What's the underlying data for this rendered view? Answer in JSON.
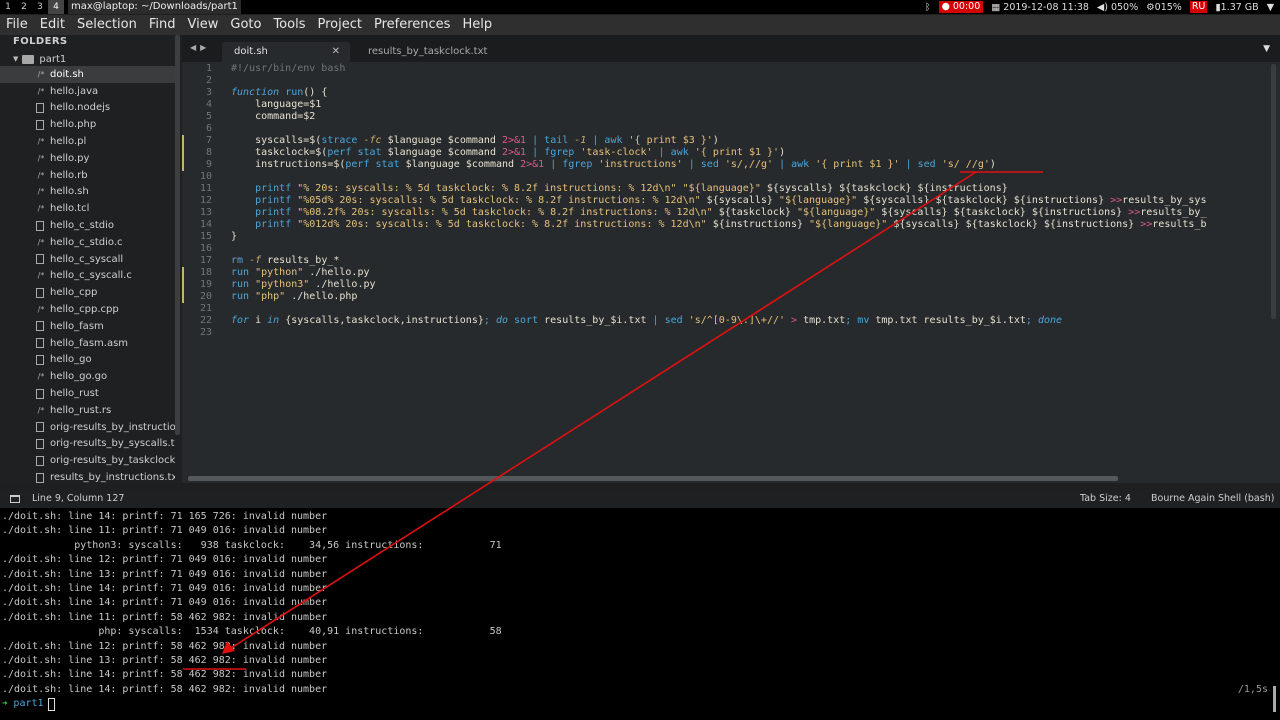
{
  "topbar": {
    "workspaces": [
      "1",
      "2",
      "3",
      "4"
    ],
    "window_title": "max@laptop: ~/Downloads/part1",
    "tray": {
      "bluetooth_icon": "bluetooth-icon",
      "record_time": "00:00",
      "datetime": "2019-12-08 11:38",
      "volume": "050%",
      "cpu": "015%",
      "keyboard_layout": "RU",
      "memory": "1.37 GB"
    }
  },
  "menubar": [
    "File",
    "Edit",
    "Selection",
    "Find",
    "View",
    "Goto",
    "Tools",
    "Project",
    "Preferences",
    "Help"
  ],
  "sidebar": {
    "header": "FOLDERS",
    "folder": "part1",
    "files": [
      {
        "name": "doit.sh",
        "type": "script"
      },
      {
        "name": "hello.java",
        "type": "script"
      },
      {
        "name": "hello.nodejs",
        "type": "doc"
      },
      {
        "name": "hello.php",
        "type": "doc"
      },
      {
        "name": "hello.pl",
        "type": "script"
      },
      {
        "name": "hello.py",
        "type": "script"
      },
      {
        "name": "hello.rb",
        "type": "script"
      },
      {
        "name": "hello.sh",
        "type": "script"
      },
      {
        "name": "hello.tcl",
        "type": "script"
      },
      {
        "name": "hello_c_stdio",
        "type": "doc"
      },
      {
        "name": "hello_c_stdio.c",
        "type": "script"
      },
      {
        "name": "hello_c_syscall",
        "type": "doc"
      },
      {
        "name": "hello_c_syscall.c",
        "type": "script"
      },
      {
        "name": "hello_cpp",
        "type": "doc"
      },
      {
        "name": "hello_cpp.cpp",
        "type": "script"
      },
      {
        "name": "hello_fasm",
        "type": "doc"
      },
      {
        "name": "hello_fasm.asm",
        "type": "doc"
      },
      {
        "name": "hello_go",
        "type": "doc"
      },
      {
        "name": "hello_go.go",
        "type": "script"
      },
      {
        "name": "hello_rust",
        "type": "doc"
      },
      {
        "name": "hello_rust.rs",
        "type": "script"
      },
      {
        "name": "orig-results_by_instructio",
        "type": "doc"
      },
      {
        "name": "orig-results_by_syscalls.tx",
        "type": "doc"
      },
      {
        "name": "orig-results_by_taskclock.",
        "type": "doc"
      },
      {
        "name": "results_by_instructions.tx",
        "type": "doc"
      }
    ]
  },
  "tabs": [
    {
      "label": "doit.sh",
      "active": true
    },
    {
      "label": "results_by_taskclock.txt",
      "active": false
    }
  ],
  "editor": {
    "line_numbers": [
      "1",
      "2",
      "3",
      "4",
      "5",
      "6",
      "7",
      "8",
      "9",
      "10",
      "11",
      "12",
      "13",
      "14",
      "15",
      "16",
      "17",
      "18",
      "19",
      "20",
      "21",
      "22",
      "23"
    ],
    "modified_lines": [
      7,
      8,
      9,
      18,
      19,
      20
    ],
    "lines": [
      "#!/usr/bin/env bash",
      "",
      "function run() {",
      "    language=$1",
      "    command=$2",
      "",
      "    syscalls=$(strace -fc $language $command 2>&1 | tail -1 | awk '{ print $3 }')",
      "    taskclock=$(perf stat $language $command 2>&1 | fgrep 'task-clock' | awk '{ print $1 }')",
      "    instructions=$(perf stat $language $command 2>&1 | fgrep 'instructions' | sed 's/,//g' | awk '{ print $1 }' | sed 's/ //g')",
      "",
      "    printf \"% 20s: syscalls: % 5d taskclock: % 8.2f instructions: % 12d\\n\" \"${language}\" ${syscalls} ${taskclock} ${instructions}",
      "    printf \"%05d% 20s: syscalls: % 5d taskclock: % 8.2f instructions: % 12d\\n\" ${syscalls} \"${language}\" ${syscalls} ${taskclock} ${instructions} >>results_by_sys",
      "    printf \"%08.2f% 20s: syscalls: % 5d taskclock: % 8.2f instructions: % 12d\\n\" ${taskclock} \"${language}\" ${syscalls} ${taskclock} ${instructions} >>results_by_",
      "    printf \"%012d% 20s: syscalls: % 5d taskclock: % 8.2f instructions: % 12d\\n\" ${instructions} \"${language}\" ${syscalls} ${taskclock} ${instructions} >>results_b",
      "}",
      "",
      "rm -f results_by_*",
      "run \"python\" ./hello.py",
      "run \"python3\" ./hello.py",
      "run \"php\" ./hello.php",
      "",
      "for i in {syscalls,taskclock,instructions}; do sort results_by_$i.txt | sed 's/^[0-9\\.]\\+//' > tmp.txt; mv tmp.txt results_by_$i.txt; done",
      ""
    ]
  },
  "statusbar": {
    "position": "Line 9, Column 127",
    "tab_size": "Tab Size: 4",
    "syntax": "Bourne Again Shell (bash)"
  },
  "terminal": {
    "lines": [
      "./doit.sh: line 14: printf: 71 165 726: invalid number",
      "./doit.sh: line 11: printf: 71 049 016: invalid number",
      "            python3: syscalls:   938 taskclock:    34,56 instructions:           71",
      "./doit.sh: line 12: printf: 71 049 016: invalid number",
      "./doit.sh: line 13: printf: 71 049 016: invalid number",
      "./doit.sh: line 14: printf: 71 049 016: invalid number",
      "./doit.sh: line 14: printf: 71 049 016: invalid number",
      "./doit.sh: line 11: printf: 58 462 982: invalid number",
      "                php: syscalls:  1534 taskclock:    40,91 instructions:           58",
      "./doit.sh: line 12: printf: 58 462 982: invalid number",
      "./doit.sh: line 13: printf: 58 462 982: invalid number",
      "./doit.sh: line 14: printf: 58 462 982: invalid number",
      "./doit.sh: line 14: printf: 58 462 982: invalid number"
    ],
    "prompt_dir": "part1",
    "right_info": "/1,5s"
  },
  "colors": {
    "annotation": "#e01010",
    "modified_marker": "#c7b469",
    "prompt_arrow": "#3fd93f"
  }
}
